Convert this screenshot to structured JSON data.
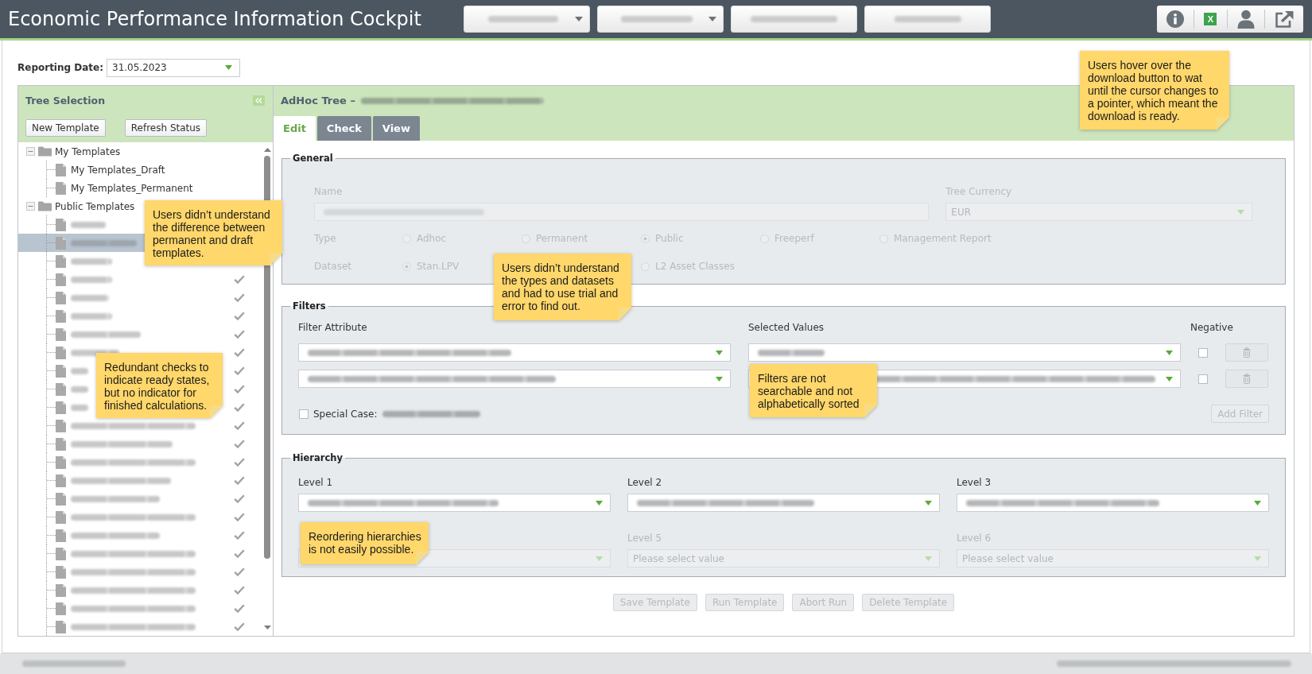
{
  "header": {
    "title": "Economic Performance Information Cockpit",
    "nav": [
      {
        "kind": "dropdown",
        "blurred": true
      },
      {
        "kind": "dropdown",
        "blurred": true
      },
      {
        "kind": "button",
        "blurred": true
      },
      {
        "kind": "button",
        "blurred": true
      }
    ],
    "tools": [
      {
        "kind": "info"
      },
      {
        "kind": "spreadsheet",
        "glyph": "X"
      },
      {
        "kind": "user"
      },
      {
        "kind": "external-link"
      }
    ]
  },
  "reporting_date": {
    "label": "Reporting Date:",
    "value": "31.05.2023"
  },
  "tree_panel": {
    "title": "Tree Selection",
    "buttons": [
      "New Template",
      "Refresh Status"
    ],
    "tree": [
      {
        "kind": "folder",
        "label": "My Templates",
        "expanded": true,
        "selected": false,
        "children": [
          {
            "kind": "file",
            "label": "My Templates_Draft",
            "ready": false,
            "selected": false
          },
          {
            "kind": "file",
            "label": "My Templates_Permanent",
            "ready": false,
            "selected": false
          }
        ]
      },
      {
        "kind": "folder",
        "label": "Public Templates",
        "expanded": true,
        "selected": false,
        "children": [
          {
            "kind": "file",
            "blurred": true,
            "selected": false
          },
          {
            "kind": "file",
            "blurred": true,
            "selected": true
          },
          {
            "kind": "file",
            "blurred": true,
            "selected": false
          },
          {
            "kind": "file",
            "blurred": true,
            "ready": true,
            "selected": false
          },
          {
            "kind": "file",
            "blurred": true,
            "ready": true,
            "selected": false
          },
          {
            "kind": "file",
            "blurred": true,
            "ready": true,
            "selected": false
          },
          {
            "kind": "file",
            "blurred": true,
            "ready": true,
            "selected": false
          },
          {
            "kind": "file",
            "blurred": true,
            "ready": true,
            "selected": false
          },
          {
            "kind": "file",
            "blurred": true,
            "ready": true,
            "selected": false
          },
          {
            "kind": "file",
            "blurred": true,
            "ready": true,
            "selected": false
          },
          {
            "kind": "file",
            "blurred": true,
            "ready": true,
            "selected": false
          },
          {
            "kind": "file",
            "blurred": true,
            "ready": true,
            "selected": false
          },
          {
            "kind": "file",
            "blurred": true,
            "ready": true,
            "selected": false
          },
          {
            "kind": "file",
            "blurred": true,
            "ready": true,
            "selected": false
          },
          {
            "kind": "file",
            "blurred": true,
            "ready": true,
            "selected": false
          },
          {
            "kind": "file",
            "blurred": true,
            "ready": true,
            "selected": false
          },
          {
            "kind": "file",
            "blurred": true,
            "ready": true,
            "selected": false
          },
          {
            "kind": "file",
            "blurred": true,
            "ready": true,
            "selected": false
          },
          {
            "kind": "file",
            "blurred": true,
            "ready": true,
            "selected": false
          },
          {
            "kind": "file",
            "blurred": true,
            "ready": true,
            "selected": false
          },
          {
            "kind": "file",
            "blurred": true,
            "ready": true,
            "selected": false
          },
          {
            "kind": "file",
            "blurred": true,
            "ready": true,
            "selected": false
          },
          {
            "kind": "file",
            "blurred": true,
            "ready": true,
            "selected": false
          }
        ]
      }
    ]
  },
  "editor": {
    "title": "AdHoc Tree –",
    "name_blurred": true,
    "tabs": [
      {
        "label": "Edit",
        "selected": true
      },
      {
        "label": "Check",
        "selected": false
      },
      {
        "label": "View",
        "selected": false
      }
    ],
    "general": {
      "legend": "General",
      "disabled": true,
      "name": {
        "label": "Name",
        "blurred": true
      },
      "currency": {
        "label": "Tree Currency",
        "value": "EUR"
      },
      "type": {
        "label": "Type",
        "options": [
          {
            "label": "Adhoc",
            "selected": false
          },
          {
            "label": "Permanent",
            "selected": false
          },
          {
            "label": "Public",
            "selected": true
          },
          {
            "label": "Freeperf",
            "selected": false
          },
          {
            "label": "Management Report",
            "selected": false
          }
        ]
      },
      "dataset": {
        "label": "Dataset",
        "options": [
          {
            "label": "Stan.LPV",
            "selected": true
          },
          {
            "label": "L2 Asset Classes",
            "selected": false
          }
        ]
      }
    },
    "filters": {
      "legend": "Filters",
      "columns": [
        "Filter Attribute",
        "Selected Values",
        "Negative"
      ],
      "rows": [
        {
          "attribute_blurred": true,
          "values_blurred": true,
          "negative": false
        },
        {
          "attribute_blurred": true,
          "values_blurred": true,
          "negative": false
        }
      ],
      "special_case": {
        "label": "Special Case:",
        "checked": false,
        "blurred": true
      },
      "add_button": {
        "label": "Add Filter",
        "disabled": true
      }
    },
    "hierarchy": {
      "legend": "Hierarchy",
      "levels": [
        {
          "label": "Level 1",
          "blurred": true,
          "disabled": false
        },
        {
          "label": "Level 2",
          "blurred": true,
          "disabled": false
        },
        {
          "label": "Level 3",
          "blurred": true,
          "disabled": false
        },
        {
          "disabled": true
        },
        {
          "label": "Level 5",
          "placeholder": "Please select value",
          "disabled": true
        },
        {
          "label": "Level 6",
          "placeholder": "Please select value",
          "disabled": true
        }
      ]
    },
    "actions": [
      {
        "label": "Save Template",
        "disabled": true
      },
      {
        "label": "Run Template",
        "disabled": true
      },
      {
        "label": "Abort Run",
        "disabled": true
      },
      {
        "label": "Delete Template",
        "disabled": true
      }
    ]
  },
  "footer": {
    "left_blurred": true,
    "right_blurred": true
  },
  "notes": [
    {
      "text": "Users hover over the download button to wat until the cursor changes to a pointer, which meant the download is ready."
    },
    {
      "text": "Users didn’t understand the difference between permanent and draft templates."
    },
    {
      "text": "Users didn’t understand the types and datasets and had to use trial and error to find out."
    },
    {
      "text": "Redundant checks to indicate ready states, but no indicator for finished calculations."
    },
    {
      "text": "Filters are not searchable and not alphabetically sorted"
    },
    {
      "text": "Reordering hierarchies is not easily possible."
    }
  ]
}
